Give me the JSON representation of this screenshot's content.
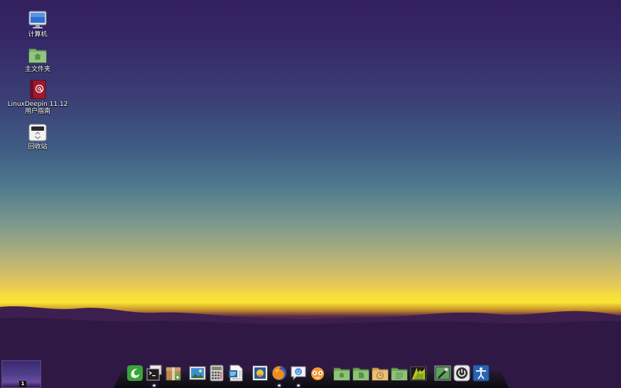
{
  "desktop_icons": [
    {
      "name": "computer",
      "label": "计算机",
      "icon": "computer-monitor-icon"
    },
    {
      "name": "home-folder",
      "label": "主文件夹",
      "icon": "home-folder-icon"
    },
    {
      "name": "user-guide",
      "label": "LinuxDeepin 11.12\n用户指南",
      "icon": "user-guide-book-icon"
    },
    {
      "name": "trash",
      "label": "回收站",
      "icon": "trash-icon"
    }
  ],
  "workspace": {
    "number": "1"
  },
  "dock": {
    "items": [
      {
        "name": "deepin-menu",
        "icon": "deepin-logo-icon",
        "running": false
      },
      {
        "name": "terminal",
        "icon": "terminal-icon",
        "running": true
      },
      {
        "name": "package-manager",
        "icon": "package-icon",
        "running": false
      },
      {
        "name": "image-viewer",
        "icon": "image-viewer-icon",
        "running": false
      },
      {
        "name": "calculator",
        "icon": "calculator-icon",
        "running": false
      },
      {
        "name": "document-writer",
        "icon": "document-writer-icon",
        "running": false
      },
      {
        "name": "mail-client",
        "icon": "mail-stamp-icon",
        "running": false
      },
      {
        "name": "firefox",
        "icon": "firefox-icon",
        "running": true
      },
      {
        "name": "chat-client",
        "icon": "chat-bubble-icon",
        "running": true
      },
      {
        "name": "music-player",
        "icon": "music-player-icon",
        "running": false
      },
      {
        "name": "home-folder",
        "icon": "home-folder-icon",
        "running": false
      },
      {
        "name": "documents-folder",
        "icon": "documents-folder-icon",
        "running": false
      },
      {
        "name": "recent-folder",
        "icon": "recent-clock-folder-icon",
        "running": false
      },
      {
        "name": "text-folder",
        "icon": "text-folder-icon",
        "running": false
      },
      {
        "name": "photos-folder",
        "icon": "photos-folder-icon",
        "running": false
      },
      {
        "name": "system-settings",
        "icon": "settings-icon",
        "running": false
      },
      {
        "name": "shutdown",
        "icon": "power-icon",
        "running": false
      },
      {
        "name": "accessibility",
        "icon": "accessibility-icon",
        "running": false
      }
    ]
  }
}
